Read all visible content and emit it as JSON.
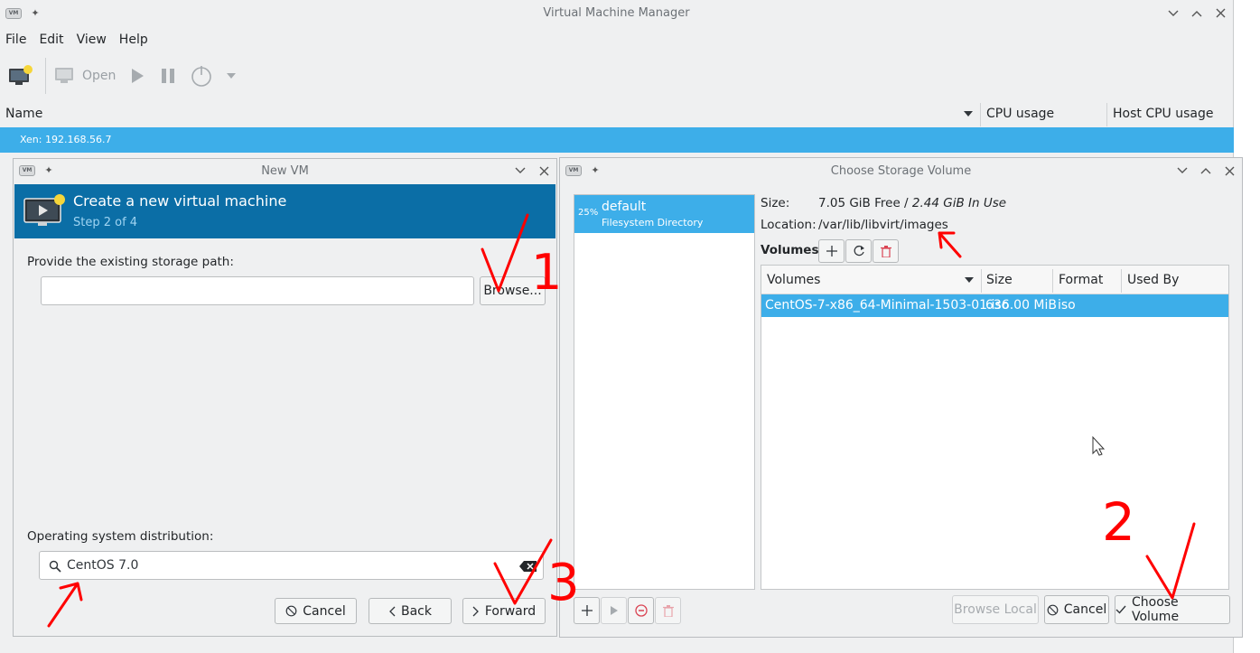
{
  "main": {
    "title": "Virtual Machine Manager",
    "logo_text": "VM",
    "menu": [
      "File",
      "Edit",
      "View",
      "Help"
    ],
    "toolbar": {
      "open_label": "Open"
    },
    "columns": {
      "name": "Name",
      "cpu": "CPU usage",
      "host_cpu": "Host CPU usage"
    },
    "connection": "Xen: 192.168.56.7"
  },
  "newvm": {
    "title": "New VM",
    "banner_title": "Create a new virtual machine",
    "banner_step": "Step 2 of 4",
    "storage_label": "Provide the existing storage path:",
    "storage_value": "",
    "browse_label": "Browse...",
    "os_label": "Operating system distribution:",
    "os_value": "CentOS 7.0",
    "cancel_label": "Cancel",
    "back_label": "Back",
    "forward_label": "Forward"
  },
  "storage": {
    "title": "Choose Storage Volume",
    "pool": {
      "percent": "25%",
      "name": "default",
      "type": "Filesystem Directory"
    },
    "size_label": "Size:",
    "size_free": "7.05 GiB Free",
    "size_sep": " / ",
    "size_used": "2.44 GiB In Use",
    "location_label": "Location:",
    "location_value": "/var/lib/libvirt/images",
    "volumes_label": "Volumes",
    "table_headers": {
      "volumes": "Volumes",
      "size": "Size",
      "format": "Format",
      "used_by": "Used By"
    },
    "rows": [
      {
        "name": "CentOS-7-x86_64-Minimal-1503-01.iso",
        "size": "636.00 MiB",
        "format": "iso",
        "used_by": ""
      }
    ],
    "browse_local_label": "Browse Local",
    "cancel_label": "Cancel",
    "choose_label": "Choose Volume"
  },
  "annotations": {
    "one": "1",
    "two": "2",
    "three": "3"
  },
  "colors": {
    "selection": "#3daee9",
    "banner": "#0b6ea6",
    "annotation": "#ff0000"
  }
}
